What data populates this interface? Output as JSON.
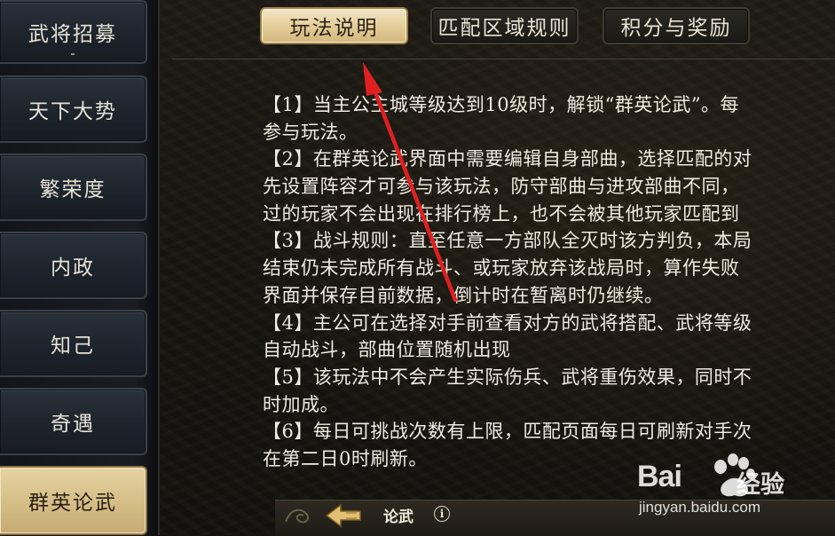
{
  "sidebar": {
    "items": [
      {
        "label": "武将招募"
      },
      {
        "label": "天下大势"
      },
      {
        "label": "繁荣度"
      },
      {
        "label": "内政"
      },
      {
        "label": "知己"
      },
      {
        "label": "奇遇"
      },
      {
        "label": "群英论武"
      }
    ],
    "active_index": 6
  },
  "tabs": [
    {
      "label": "玩法说明"
    },
    {
      "label": "匹配区域规则"
    },
    {
      "label": "积分与奖励"
    }
  ],
  "rules_lines": [
    "【1】当主公主城等级达到10级时，解锁“群英论武”。每",
    "参与玩法。",
    "【2】在群英论武界面中需要编辑自身部曲，选择匹配的对",
    "先设置阵容才可参与该玩法，防守部曲与进攻部曲不同，",
    "过的玩家不会出现在排行榜上，也不会被其他玩家匹配到",
    "【3】战斗规则：直至任意一方部队全灭时该方判负，本局",
    "结束仍未完成所有战斗、或玩家放弃该战局时，算作失败",
    "界面并保存目前数据，倒计时在暂离时仍继续。",
    "【4】主公可在选择对手前查看对方的武将搭配、武将等级",
    "自动战斗，部曲位置随机出现",
    "【5】该玩法中不会产生实际伤兵、武将重伤效果，同时不",
    "时加成。",
    "【6】每日可挑战次数有上限，匹配页面每日可刷新对手次",
    "在第二日0时刷新。"
  ],
  "bottom_bar": {
    "label": "论武",
    "info_icon": "i"
  },
  "watermark": {
    "brand": "Bai",
    "brand_suffix": "经验",
    "url": "jingyan.baidu.com"
  },
  "colors": {
    "accent_gold": "#e2cc97",
    "annotation_arrow": "#e02020",
    "text": "#f0ece2"
  }
}
